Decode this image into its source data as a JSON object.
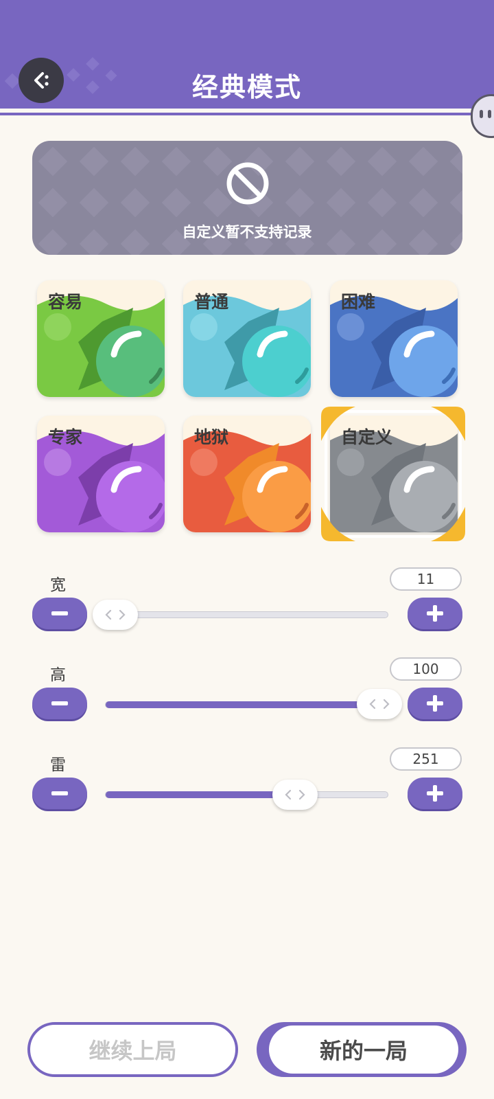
{
  "header": {
    "title": "经典模式",
    "back_icon": "back-arrow-icon"
  },
  "notice": {
    "icon": "prohibited-icon",
    "text": "自定义暂不支持记录"
  },
  "difficulties": [
    {
      "label": "容易",
      "color": "#7ac943",
      "selected": false
    },
    {
      "label": "普通",
      "color": "#6cc8dc",
      "selected": false
    },
    {
      "label": "困难",
      "color": "#4a74c4",
      "selected": false
    },
    {
      "label": "专家",
      "color": "#a35ad8",
      "selected": false
    },
    {
      "label": "地狱",
      "color": "#e85c3f",
      "selected": false
    },
    {
      "label": "自定义",
      "color": "#868a8f",
      "selected": true
    }
  ],
  "sliders": [
    {
      "label": "宽",
      "value": "11",
      "fraction": 0.0
    },
    {
      "label": "高",
      "value": "100",
      "fraction": 1.0
    },
    {
      "label": "雷",
      "value": "251",
      "fraction": 0.68
    }
  ],
  "buttons": {
    "continue": "继续上局",
    "new_game": "新的一局"
  },
  "colors": {
    "accent": "#7866c0",
    "background": "#fbf8f2",
    "selected_frame": "#f5b82e"
  }
}
